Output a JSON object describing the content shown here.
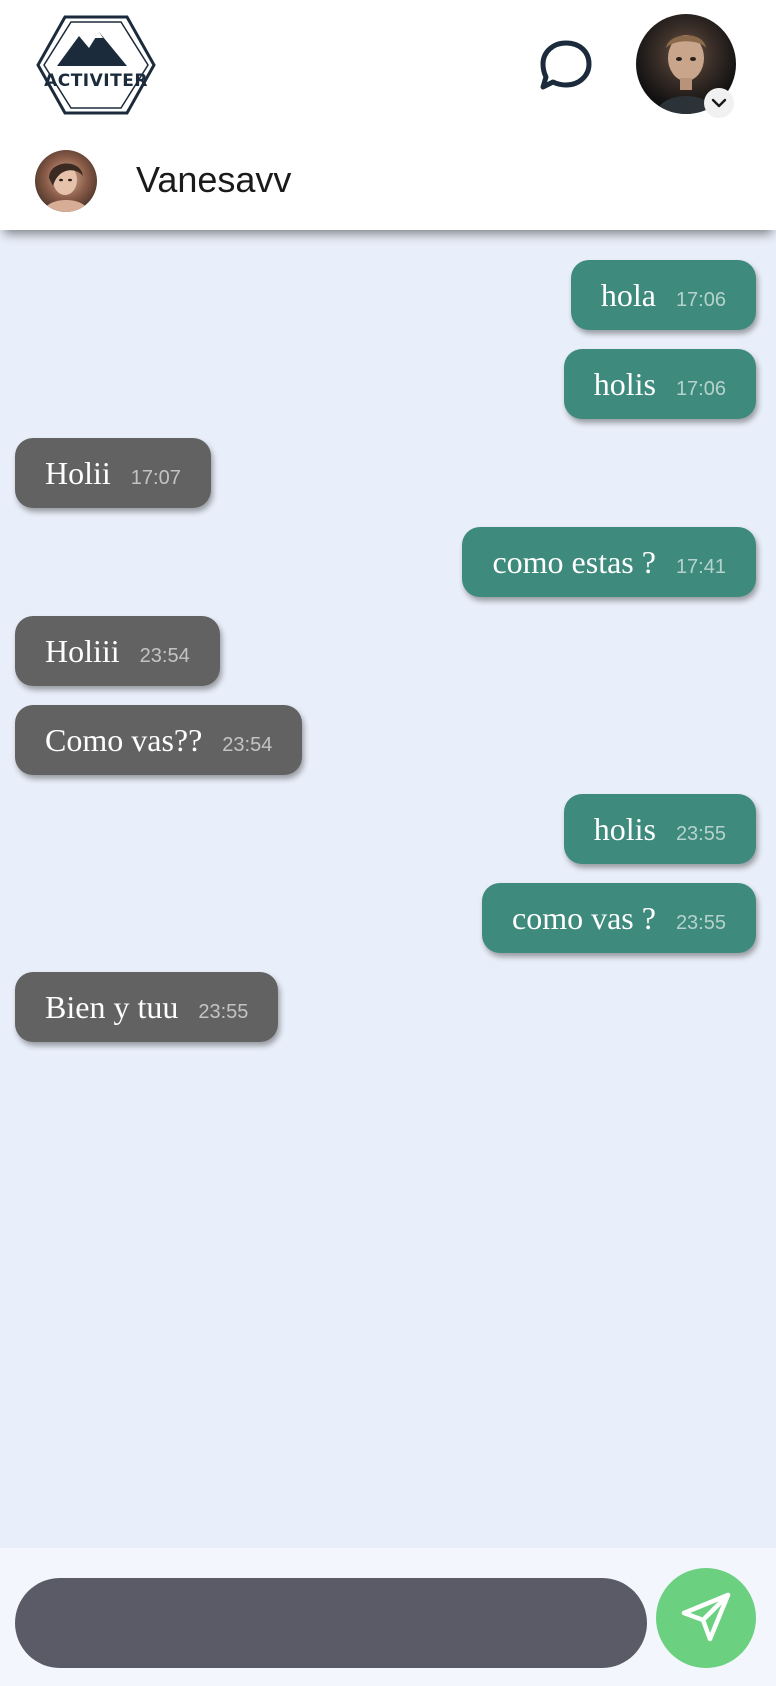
{
  "app": {
    "logo_text": "ACTIVITER",
    "colors": {
      "sent_bubble": "#3e8a7c",
      "received_bubble": "#626262",
      "chat_background": "#e9effa",
      "send_button": "#6bd07f",
      "input_background": "#5b5b67"
    }
  },
  "header": {
    "chat_icon": "speech-bubble-icon",
    "profile_menu_icon": "chevron-down-icon"
  },
  "contact": {
    "name": "Vanesavv"
  },
  "messages": [
    {
      "direction": "sent",
      "text": "hola",
      "time": "17:06"
    },
    {
      "direction": "sent",
      "text": "holis",
      "time": "17:06"
    },
    {
      "direction": "received",
      "text": "Holii",
      "time": "17:07"
    },
    {
      "direction": "sent",
      "text": "como estas ?",
      "time": "17:41"
    },
    {
      "direction": "received",
      "text": "Holiii",
      "time": "23:54"
    },
    {
      "direction": "received",
      "text": "Como vas??",
      "time": "23:54"
    },
    {
      "direction": "sent",
      "text": "holis",
      "time": "23:55"
    },
    {
      "direction": "sent",
      "text": "como vas ?",
      "time": "23:55"
    },
    {
      "direction": "received",
      "text": "Bien y tuu",
      "time": "23:55"
    }
  ],
  "composer": {
    "input_value": "",
    "send_icon": "paper-plane-icon"
  }
}
